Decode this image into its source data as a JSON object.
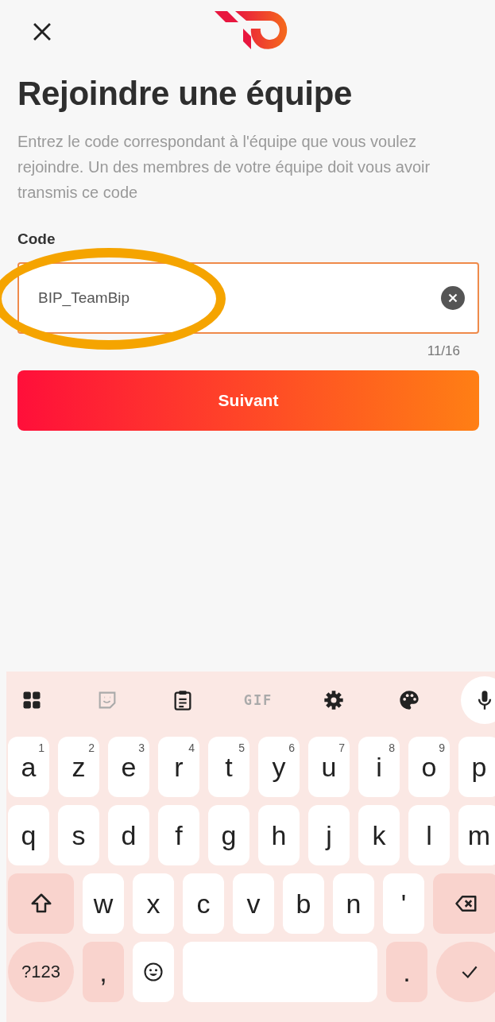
{
  "title": "Rejoindre une équipe",
  "description": "Entrez le code correspondant à l'équipe que vous voulez rejoindre. Un des membres de votre équipe doit vous avoir transmis ce code",
  "code_field": {
    "label": "Code",
    "value": "BIP_TeamBip",
    "counter": "11/16"
  },
  "submit_button": "Suivant",
  "keyboard": {
    "toolbar": [
      {
        "kind": "apps",
        "disabled": false
      },
      {
        "kind": "sticker",
        "disabled": true
      },
      {
        "kind": "clipboard",
        "disabled": false
      },
      {
        "kind": "gif",
        "label": "GIF",
        "disabled": true
      },
      {
        "kind": "settings",
        "disabled": false
      },
      {
        "kind": "palette",
        "disabled": false
      },
      {
        "kind": "mic",
        "disabled": false
      }
    ],
    "rows": [
      [
        {
          "kind": "char",
          "label": "a",
          "hint": "1"
        },
        {
          "kind": "char",
          "label": "z",
          "hint": "2"
        },
        {
          "kind": "char",
          "label": "e",
          "hint": "3"
        },
        {
          "kind": "char",
          "label": "r",
          "hint": "4"
        },
        {
          "kind": "char",
          "label": "t",
          "hint": "5"
        },
        {
          "kind": "char",
          "label": "y",
          "hint": "6"
        },
        {
          "kind": "char",
          "label": "u",
          "hint": "7"
        },
        {
          "kind": "char",
          "label": "i",
          "hint": "8"
        },
        {
          "kind": "char",
          "label": "o",
          "hint": "9"
        },
        {
          "kind": "char",
          "label": "p"
        }
      ],
      [
        {
          "kind": "char",
          "label": "q"
        },
        {
          "kind": "char",
          "label": "s"
        },
        {
          "kind": "char",
          "label": "d"
        },
        {
          "kind": "char",
          "label": "f"
        },
        {
          "kind": "char",
          "label": "g"
        },
        {
          "kind": "char",
          "label": "h"
        },
        {
          "kind": "char",
          "label": "j"
        },
        {
          "kind": "char",
          "label": "k"
        },
        {
          "kind": "char",
          "label": "l"
        },
        {
          "kind": "char",
          "label": "m"
        }
      ],
      [
        {
          "kind": "shift"
        },
        {
          "kind": "char",
          "label": "w"
        },
        {
          "kind": "char",
          "label": "x"
        },
        {
          "kind": "char",
          "label": "c"
        },
        {
          "kind": "char",
          "label": "v"
        },
        {
          "kind": "char",
          "label": "b"
        },
        {
          "kind": "char",
          "label": "n"
        },
        {
          "kind": "char",
          "label": "'"
        },
        {
          "kind": "backspace"
        }
      ],
      [
        {
          "kind": "symbols",
          "label": "?123"
        },
        {
          "kind": "punct",
          "label": ","
        },
        {
          "kind": "emoji"
        },
        {
          "kind": "space"
        },
        {
          "kind": "punct",
          "label": "."
        },
        {
          "kind": "enter"
        }
      ]
    ]
  }
}
